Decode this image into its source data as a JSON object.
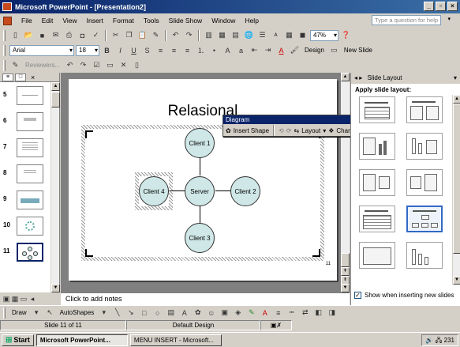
{
  "window": {
    "title": "Microsoft PowerPoint - [Presentation2]",
    "min": "_",
    "max": "▫",
    "close": "×"
  },
  "menu": {
    "items": [
      {
        "label": "File"
      },
      {
        "label": "Edit"
      },
      {
        "label": "View"
      },
      {
        "label": "Insert"
      },
      {
        "label": "Format"
      },
      {
        "label": "Tools"
      },
      {
        "label": "Slide Show"
      },
      {
        "label": "Window"
      },
      {
        "label": "Help"
      }
    ],
    "ask_placeholder": "Type a question for help"
  },
  "standard_toolbar": {
    "zoom": "47%"
  },
  "format_toolbar": {
    "font": "Arial",
    "size": "18",
    "design_label": "Design",
    "new_slide_label": "New Slide"
  },
  "reviewing_toolbar": {
    "reviewers_label": "Reviewers..."
  },
  "slides": [
    {
      "num": "5"
    },
    {
      "num": "6"
    },
    {
      "num": "7"
    },
    {
      "num": "8"
    },
    {
      "num": "9"
    },
    {
      "num": "10"
    },
    {
      "num": "11"
    }
  ],
  "slide": {
    "title": "Relasional",
    "nodes": {
      "top": "Client 1",
      "left": "Client 4",
      "center": "Server",
      "right": "Client 2",
      "bottom": "Client 3"
    },
    "number": "11"
  },
  "diagram_toolbar": {
    "title": "Diagram",
    "insert_shape": "Insert Shape",
    "layout": "Layout",
    "change_to": "Change to"
  },
  "notes": {
    "placeholder": "Click to add notes"
  },
  "task_pane": {
    "title": "Slide Layout",
    "subtitle": "Apply slide layout:",
    "show_when_inserting": "Show when inserting new slides"
  },
  "drawing_toolbar": {
    "draw_label": "Draw",
    "autoshapes_label": "AutoShapes"
  },
  "status": {
    "slide_of": "Slide 11 of 11",
    "design": "Default Design"
  },
  "taskbar": {
    "start": "Start",
    "tasks": [
      {
        "label": "Microsoft PowerPoint..."
      },
      {
        "label": "MENU INSERT - Microsoft..."
      }
    ],
    "clock": "231"
  }
}
